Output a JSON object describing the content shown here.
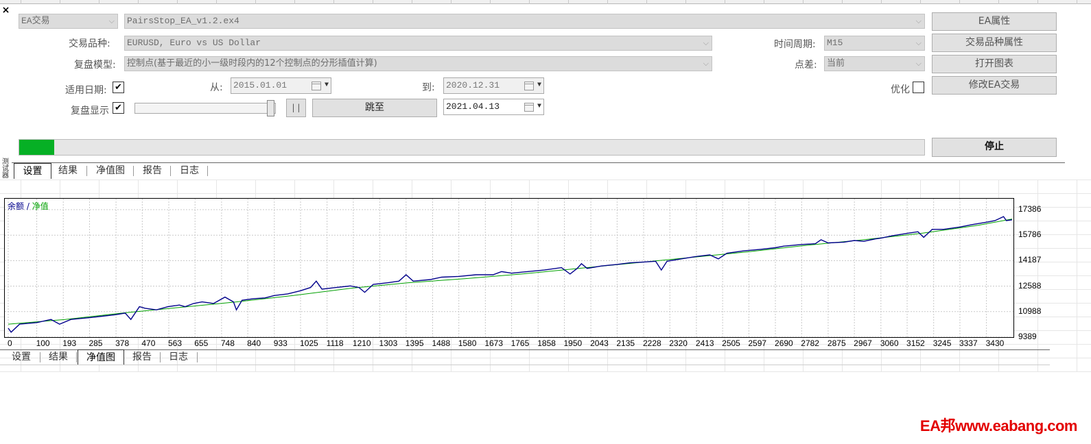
{
  "window": {
    "close": "×",
    "side_label": "测试器"
  },
  "settings": {
    "ea_type": "EA交易",
    "ea_file": "PairsStop_EA_v1.2.ex4",
    "symbol_label": "交易品种:",
    "symbol_value": "EURUSD, Euro vs US Dollar",
    "model_label": "复盘模型:",
    "model_value": "控制点(基于最近的小一级时段内的12个控制点的分形插值计算)",
    "use_date_label": "适用日期:",
    "visual_label": "复盘显示",
    "from_label": "从:",
    "from_value": "2015.01.01",
    "to_label": "到:",
    "to_value": "2020.12.31",
    "skip_to_label": "跳至",
    "skip_to_value": "2021.04.13",
    "pause_label": "| |",
    "period_label": "时间周期:",
    "period_value": "M15",
    "spread_label": "点差:",
    "spread_value": "当前",
    "optimize_label": "优化",
    "use_date_checked": "✔",
    "visual_checked": "✔",
    "progress": 0.039
  },
  "buttons": {
    "ea_props": "EA属性",
    "symbol_props": "交易品种属性",
    "open_chart": "打开图表",
    "modify_ea": "修改EA交易",
    "stop": "停止"
  },
  "tabs_top": [
    "设置",
    "结果",
    "净值图",
    "报告",
    "日志"
  ],
  "tabs_bottom": [
    "设置",
    "结果",
    "净值图",
    "报告",
    "日志"
  ],
  "watermark": "EA邦www.eabang.com",
  "colors": {
    "balance": "#00008b",
    "equity": "#00a000",
    "progress": "#06b025",
    "watermark": "#e30000"
  },
  "chart_data": {
    "type": "line",
    "legend": {
      "balance": "余额",
      "separator": " / ",
      "equity": "净值",
      "position": "top-left"
    },
    "y_ticks": [
      9389,
      10988,
      12588,
      14187,
      15786,
      17386
    ],
    "x_ticks": [
      0,
      100,
      193,
      285,
      378,
      470,
      563,
      655,
      748,
      840,
      933,
      1025,
      1118,
      1210,
      1303,
      1395,
      1488,
      1580,
      1673,
      1765,
      1858,
      1950,
      2043,
      2135,
      2228,
      2320,
      2413,
      2505,
      2597,
      2690,
      2782,
      2875,
      2967,
      3060,
      3152,
      3245,
      3337,
      3430
    ],
    "xlim": [
      0,
      3520
    ],
    "ylim": [
      9389,
      17386
    ],
    "grid": true,
    "series": [
      {
        "name": "余额",
        "points": [
          [
            0,
            10200
          ],
          [
            200,
            10500
          ],
          [
            400,
            10900
          ],
          [
            600,
            11250
          ],
          [
            800,
            11600
          ],
          [
            1000,
            12000
          ],
          [
            1200,
            12450
          ],
          [
            1400,
            12800
          ],
          [
            1600,
            13050
          ],
          [
            1800,
            13350
          ],
          [
            2000,
            13700
          ],
          [
            2200,
            14050
          ],
          [
            2400,
            14400
          ],
          [
            2600,
            14750
          ],
          [
            2800,
            15150
          ],
          [
            3000,
            15500
          ],
          [
            3200,
            15900
          ],
          [
            3400,
            16400
          ],
          [
            3520,
            16800
          ]
        ]
      },
      {
        "name": "净值",
        "points": [
          [
            0,
            9950
          ],
          [
            10,
            9700
          ],
          [
            40,
            10200
          ],
          [
            100,
            10300
          ],
          [
            150,
            10500
          ],
          [
            180,
            10200
          ],
          [
            220,
            10500
          ],
          [
            280,
            10600
          ],
          [
            330,
            10700
          ],
          [
            378,
            10800
          ],
          [
            410,
            10900
          ],
          [
            430,
            10500
          ],
          [
            460,
            11300
          ],
          [
            480,
            11200
          ],
          [
            520,
            11100
          ],
          [
            560,
            11300
          ],
          [
            600,
            11400
          ],
          [
            620,
            11300
          ],
          [
            650,
            11500
          ],
          [
            680,
            11600
          ],
          [
            720,
            11500
          ],
          [
            760,
            11900
          ],
          [
            790,
            11600
          ],
          [
            800,
            11100
          ],
          [
            820,
            11700
          ],
          [
            860,
            11800
          ],
          [
            900,
            11850
          ],
          [
            933,
            12000
          ],
          [
            980,
            12100
          ],
          [
            1025,
            12300
          ],
          [
            1060,
            12500
          ],
          [
            1080,
            12900
          ],
          [
            1100,
            12400
          ],
          [
            1150,
            12500
          ],
          [
            1200,
            12600
          ],
          [
            1230,
            12500
          ],
          [
            1250,
            12200
          ],
          [
            1280,
            12700
          ],
          [
            1330,
            12800
          ],
          [
            1370,
            12900
          ],
          [
            1395,
            13300
          ],
          [
            1420,
            12900
          ],
          [
            1480,
            13000
          ],
          [
            1520,
            13150
          ],
          [
            1580,
            13200
          ],
          [
            1640,
            13300
          ],
          [
            1700,
            13300
          ],
          [
            1730,
            13500
          ],
          [
            1765,
            13400
          ],
          [
            1820,
            13500
          ],
          [
            1880,
            13600
          ],
          [
            1940,
            13750
          ],
          [
            1970,
            13350
          ],
          [
            1995,
            13700
          ],
          [
            2010,
            14000
          ],
          [
            2030,
            13700
          ],
          [
            2080,
            13850
          ],
          [
            2135,
            13950
          ],
          [
            2180,
            14050
          ],
          [
            2228,
            14100
          ],
          [
            2270,
            14150
          ],
          [
            2290,
            13600
          ],
          [
            2310,
            14150
          ],
          [
            2360,
            14300
          ],
          [
            2413,
            14450
          ],
          [
            2460,
            14550
          ],
          [
            2490,
            14300
          ],
          [
            2520,
            14650
          ],
          [
            2580,
            14800
          ],
          [
            2640,
            14900
          ],
          [
            2690,
            15000
          ],
          [
            2720,
            15100
          ],
          [
            2782,
            15200
          ],
          [
            2830,
            15250
          ],
          [
            2850,
            15500
          ],
          [
            2875,
            15300
          ],
          [
            2930,
            15350
          ],
          [
            2967,
            15450
          ],
          [
            3000,
            15400
          ],
          [
            3040,
            15550
          ],
          [
            3060,
            15600
          ],
          [
            3100,
            15750
          ],
          [
            3152,
            15900
          ],
          [
            3190,
            16000
          ],
          [
            3210,
            15650
          ],
          [
            3240,
            16150
          ],
          [
            3280,
            16150
          ],
          [
            3337,
            16300
          ],
          [
            3380,
            16450
          ],
          [
            3430,
            16600
          ],
          [
            3460,
            16700
          ],
          [
            3490,
            16950
          ],
          [
            3500,
            16700
          ],
          [
            3520,
            16750
          ]
        ]
      }
    ]
  }
}
